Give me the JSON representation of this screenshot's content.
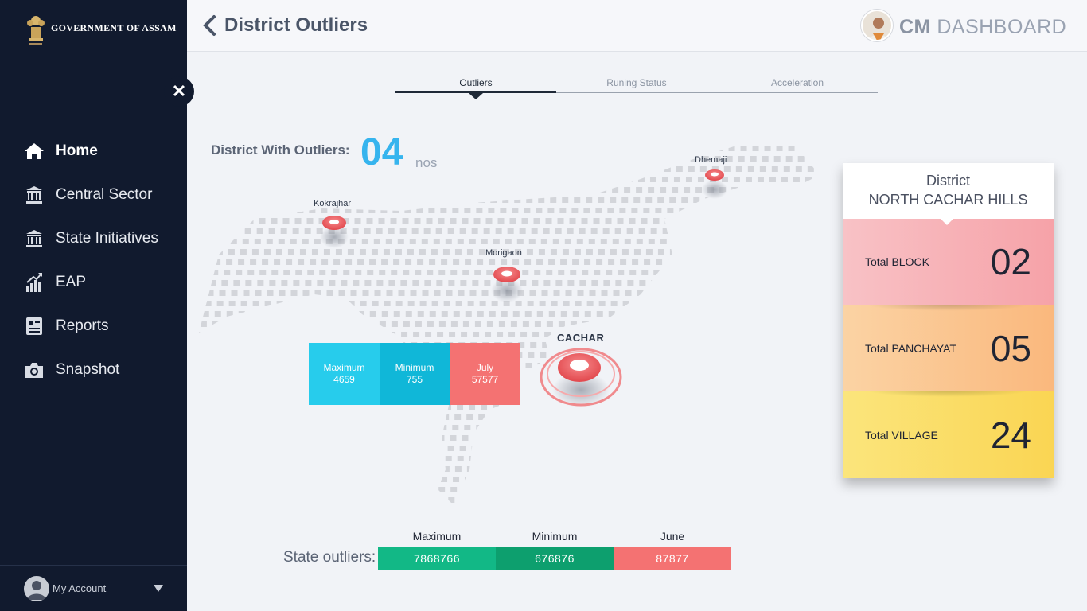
{
  "sidebar": {
    "logo_text": "GOVERNMENT OF ASSAM",
    "close_glyph": "✕",
    "items": [
      {
        "label": "Home",
        "icon": "home-icon"
      },
      {
        "label": "Central Sector",
        "icon": "bank-icon"
      },
      {
        "label": "State Initiatives",
        "icon": "bank-icon"
      },
      {
        "label": "EAP",
        "icon": "growth-chart-icon"
      },
      {
        "label": "Reports",
        "icon": "report-icon"
      },
      {
        "label": "Snapshot",
        "icon": "camera-icon"
      }
    ],
    "account_label": "My Account"
  },
  "header": {
    "title": "District Outliers",
    "brand_bold": "CM",
    "brand_rest": "DASHBOARD"
  },
  "tabs": [
    "Outliers",
    "Runing Status",
    "Acceleration"
  ],
  "outliers": {
    "label": "District With Outliers:",
    "count": "04",
    "unit": "nos"
  },
  "map": {
    "pins": [
      "Kokrajhar",
      "Morigaon",
      "Dhemaji",
      "CACHAR"
    ]
  },
  "metrics": [
    {
      "label": "Maximum",
      "value": "4659"
    },
    {
      "label": "Minimum",
      "value": "755"
    },
    {
      "label": "July",
      "value": "57577"
    }
  ],
  "district_card": {
    "line1": "District",
    "line2": "NORTH CACHAR HILLS",
    "rows": [
      {
        "label": "Total BLOCK",
        "value": "02"
      },
      {
        "label": "Total PANCHAYAT",
        "value": "05"
      },
      {
        "label": "Total VILLAGE",
        "value": "24"
      }
    ]
  },
  "state_outliers": {
    "label": "State outliers:",
    "columns": [
      {
        "label": "Maximum",
        "value": "7868766",
        "color": "#12b886"
      },
      {
        "label": "Minimum",
        "value": "676876",
        "color": "#0d9f6e"
      },
      {
        "label": "June",
        "value": "87877",
        "color": "#f47272"
      }
    ]
  },
  "colors": {
    "sidebar_bg": "#111a2e",
    "accent_blue": "#36b4ee",
    "pin_red": "#ee5a5e"
  }
}
